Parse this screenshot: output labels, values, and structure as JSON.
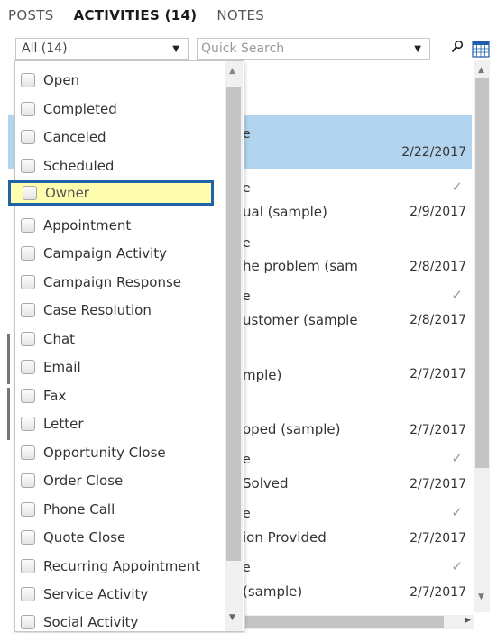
{
  "tabs": [
    {
      "label": "POSTS"
    },
    {
      "label": "ACTIVITIES (14)"
    },
    {
      "label": "NOTES"
    }
  ],
  "filter": {
    "selected": "All (14)"
  },
  "search": {
    "placeholder": "Quick Search"
  },
  "icons": {
    "search": "search-icon",
    "calendar": "calendar-icon",
    "check": "checkmark-icon",
    "arrow": "chevron-down-icon"
  },
  "colors": {
    "selected_row": "#b2d4ee",
    "highlight_fill": "#fffdae",
    "highlight_border": "#2064a8"
  },
  "dropdown_options": [
    {
      "label": "Open"
    },
    {
      "label": "Completed"
    },
    {
      "label": "Canceled"
    },
    {
      "label": "Scheduled"
    },
    {
      "label": "Owner"
    },
    {
      "label": "Appointment"
    },
    {
      "label": "Campaign Activity"
    },
    {
      "label": "Campaign Response"
    },
    {
      "label": "Case Resolution"
    },
    {
      "label": "Chat"
    },
    {
      "label": "Email"
    },
    {
      "label": "Fax"
    },
    {
      "label": "Letter"
    },
    {
      "label": "Opportunity Close"
    },
    {
      "label": "Order Close"
    },
    {
      "label": "Phone Call"
    },
    {
      "label": "Quote Close"
    },
    {
      "label": "Recurring Appointment"
    },
    {
      "label": "Service Activity"
    },
    {
      "label": "Social Activity"
    }
  ],
  "activities": [
    {
      "top": "e",
      "title": "",
      "date": "2/22/2017",
      "completed": false,
      "selected": true
    },
    {
      "top": "e",
      "title": "ual (sample)",
      "date": "2/9/2017",
      "completed": true,
      "selected": false
    },
    {
      "top": "e",
      "title": "he problem (sam",
      "date": "2/8/2017",
      "completed": false,
      "selected": false
    },
    {
      "top": "e",
      "title": "ustomer (sample",
      "date": "2/8/2017",
      "completed": true,
      "selected": false
    },
    {
      "top": "",
      "title": "mple)",
      "date": "2/7/2017",
      "completed": false,
      "selected": false
    },
    {
      "top": "",
      "title": "oped (sample)",
      "date": "2/7/2017",
      "completed": false,
      "selected": false
    },
    {
      "top": "e",
      "title": "Solved",
      "date": "2/7/2017",
      "completed": true,
      "selected": false
    },
    {
      "top": "e",
      "title": "ion Provided",
      "date": "2/7/2017",
      "completed": true,
      "selected": false
    },
    {
      "top": "e",
      "title": "(sample)",
      "date": "2/7/2017",
      "completed": true,
      "selected": false
    }
  ]
}
